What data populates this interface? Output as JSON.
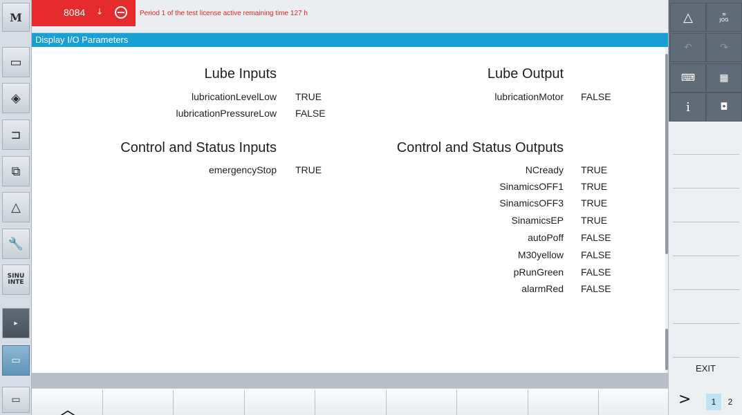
{
  "alarm": {
    "number": "8084",
    "arrow": "↓",
    "message": "Period 1 of the test license active remaining time 127 h",
    "color": "#e62b2f"
  },
  "title": "Display I/O Parameters",
  "lube_inputs": {
    "title": "Lube Inputs",
    "params": [
      {
        "name": "lubricationLevelLow",
        "value": "TRUE"
      },
      {
        "name": "lubricationPressureLow",
        "value": "FALSE"
      }
    ]
  },
  "lube_output": {
    "title": "Lube Output",
    "params": [
      {
        "name": "lubricationMotor",
        "value": "FALSE"
      }
    ]
  },
  "control_inputs": {
    "title": "Control and Status Inputs",
    "params": [
      {
        "name": "emergencyStop",
        "value": "TRUE"
      }
    ]
  },
  "control_outputs": {
    "title": "Control and Status Outputs",
    "params": [
      {
        "name": "NCready",
        "value": "TRUE"
      },
      {
        "name": "SinamicsOFF1",
        "value": "TRUE"
      },
      {
        "name": "SinamicsOFF3",
        "value": "TRUE"
      },
      {
        "name": "SinamicsEP",
        "value": "TRUE"
      },
      {
        "name": "autoPoff",
        "value": "FALSE"
      },
      {
        "name": "M30yellow",
        "value": "FALSE"
      },
      {
        "name": "pRunGreen",
        "value": "FALSE"
      },
      {
        "name": "alarmRed",
        "value": "FALSE"
      }
    ]
  },
  "left_bar": {
    "machine_label": "M",
    "sinumerik_label": "SINU\nINTE",
    "icons": [
      "machine-icon",
      "program-icon",
      "offset-icon",
      "program-manager-icon",
      "copy-icon",
      "diagnostics-icon",
      "setup-wrench-icon",
      "sinumerik-integrate-icon",
      "expand-arrow-icon",
      "window-icon",
      "window-icon"
    ]
  },
  "right_bar": {
    "jog_label": "JOG",
    "info_label": "i",
    "exit_label": "EXIT",
    "next_label": ">",
    "pages": [
      "1",
      "2"
    ],
    "current_page": "1"
  },
  "bottom_bar": {
    "up_label": "︿"
  },
  "colors": {
    "title_bar": "#1a9fd5",
    "accent_dark": "#5f6b77",
    "page_highlight": "#bde3f5"
  }
}
